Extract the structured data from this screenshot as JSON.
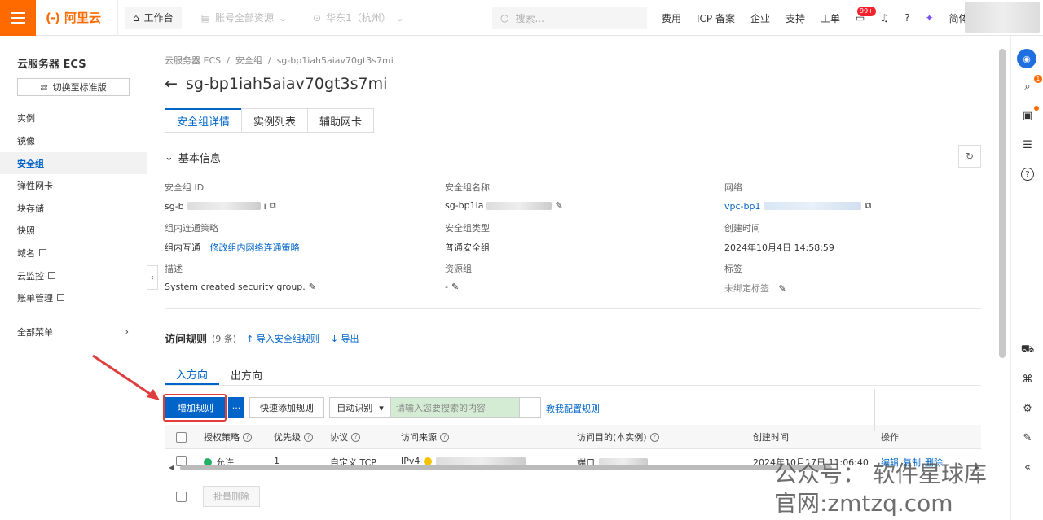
{
  "topbar": {
    "logo_text": "阿里云",
    "logo_mark": "(-)",
    "workbench": "工作台",
    "account_resources": "账号全部资源",
    "region": "华东1（杭州）",
    "search_placeholder": "搜索...",
    "menu": [
      "费用",
      "ICP 备案",
      "企业",
      "支持",
      "工单"
    ],
    "bell_badge": "99+",
    "language": "简体"
  },
  "sidebar": {
    "title": "云服务器 ECS",
    "switch_label": "切换至标准版",
    "items": [
      {
        "label": "实例"
      },
      {
        "label": "镜像"
      },
      {
        "label": "安全组"
      },
      {
        "label": "弹性网卡"
      },
      {
        "label": "块存储"
      },
      {
        "label": "快照"
      },
      {
        "label": "域名"
      },
      {
        "label": "云监控"
      },
      {
        "label": "账单管理"
      }
    ],
    "all_menu": "全部菜单"
  },
  "breadcrumb": [
    "云服务器 ECS",
    "/",
    "安全组",
    "/",
    "sg-bp1iah5aiav70gt3s7mi"
  ],
  "page_title": "sg-bp1iah5aiav70gt3s7mi",
  "tabs": [
    "安全组详情",
    "实例列表",
    "辅助网卡"
  ],
  "basic_info": {
    "heading": "基本信息",
    "sg_id_label": "安全组 ID",
    "sg_id_prefix": "sg-b",
    "sg_id_suffix": "i",
    "sg_name_label": "安全组名称",
    "sg_name_value": "sg-bp1ia",
    "network_label": "网络",
    "network_value": "vpc-bp1",
    "policy_label": "组内连通策略",
    "policy_value": "组内互通",
    "policy_link": "修改组内网络连通策略",
    "type_label": "安全组类型",
    "type_value": "普通安全组",
    "created_label": "创建时间",
    "created_value": "2024年10月4日 14:58:59",
    "desc_label": "描述",
    "desc_value": "System created security group.",
    "rg_label": "资源组",
    "rg_value": "-",
    "tag_label": "标签",
    "tag_value": "未绑定标签"
  },
  "rules": {
    "title": "访问规则",
    "count": "(9 条)",
    "import": "导入安全组规则",
    "export": "导出",
    "direction_tabs": [
      "入方向",
      "出方向"
    ],
    "add_rule": "增加规则",
    "more": "···",
    "quick_add": "快速添加规则",
    "auto_detect": "自动识别",
    "search_placeholder": "请输入您要搜索的内容",
    "help_link": "教我配置规则",
    "columns": [
      "授权策略",
      "优先级",
      "协议",
      "访问来源",
      "访问目的(本实例)",
      "创建时间",
      "操作"
    ],
    "row": {
      "policy": "允许",
      "priority": "1",
      "protocol": "自定义 TCP",
      "source": "IPv4",
      "dest": "端口",
      "created": "2024年10月17日 11:06:40",
      "ops": [
        "编辑",
        "复制",
        "删除"
      ]
    },
    "batch_delete": "批量删除"
  },
  "watermark": {
    "line1": "公众号：  软件星球库",
    "line2": "官网:zmtzq.com"
  },
  "colors": {
    "brand": "#ff6a00",
    "primary": "#0064c8",
    "annotation": "#e03e3e"
  }
}
